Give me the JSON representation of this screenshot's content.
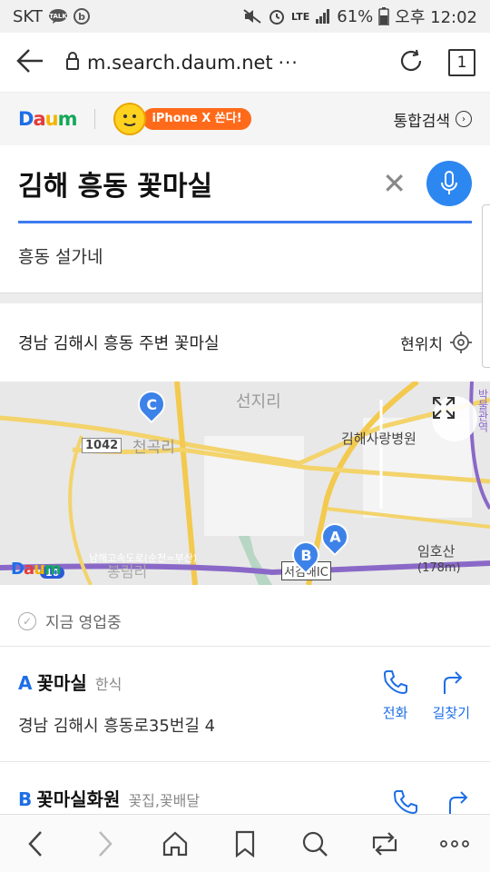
{
  "status_bar": {
    "carrier": "SKT",
    "talk_icon": "talk-icon",
    "b_icon": "b-app-icon",
    "network": "LTE",
    "battery": "61%",
    "time": "오후 12:02"
  },
  "browser": {
    "url": "m.search.daum.net",
    "more": "···",
    "tab_count": "1"
  },
  "header": {
    "logo": {
      "d": "D",
      "a": "a",
      "u": "u",
      "m": "m"
    },
    "promo_text": "iPhone X 쏜다!",
    "integrated_search": "통합검색"
  },
  "search": {
    "query": "김해 흥동 꽃마실",
    "suggestion": "흥동 설가네"
  },
  "map_section": {
    "title": "경남 김해시 흥동 주변 꽃마실",
    "current_location": "현위치",
    "labels": {
      "seonjiri": "선지리",
      "cheongokri": "천곡리",
      "hospital": "김해사랑병원",
      "mountain": "임호산",
      "mountain_height": "(178m)",
      "road1042": "1042",
      "expressway": "남해고속도로(순천=부산)",
      "ic": "서김해IC",
      "daedong": "봉림리",
      "bakmul": "박물관역",
      "route10": "10"
    },
    "pins": [
      "A",
      "B",
      "C"
    ]
  },
  "open_now": "지금 영업중",
  "results": [
    {
      "letter": "A",
      "name": "꽃마실",
      "category": "한식",
      "address": "경남 김해시 흥동로35번길 4",
      "call": "전화",
      "directions": "길찾기"
    },
    {
      "letter": "B",
      "name": "꽃마실화원",
      "category": "꽃집,꽃배달"
    }
  ],
  "colors": {
    "accent": "#1d6ee6",
    "mic": "#2d87f0",
    "promo": "#ff6a1a"
  }
}
